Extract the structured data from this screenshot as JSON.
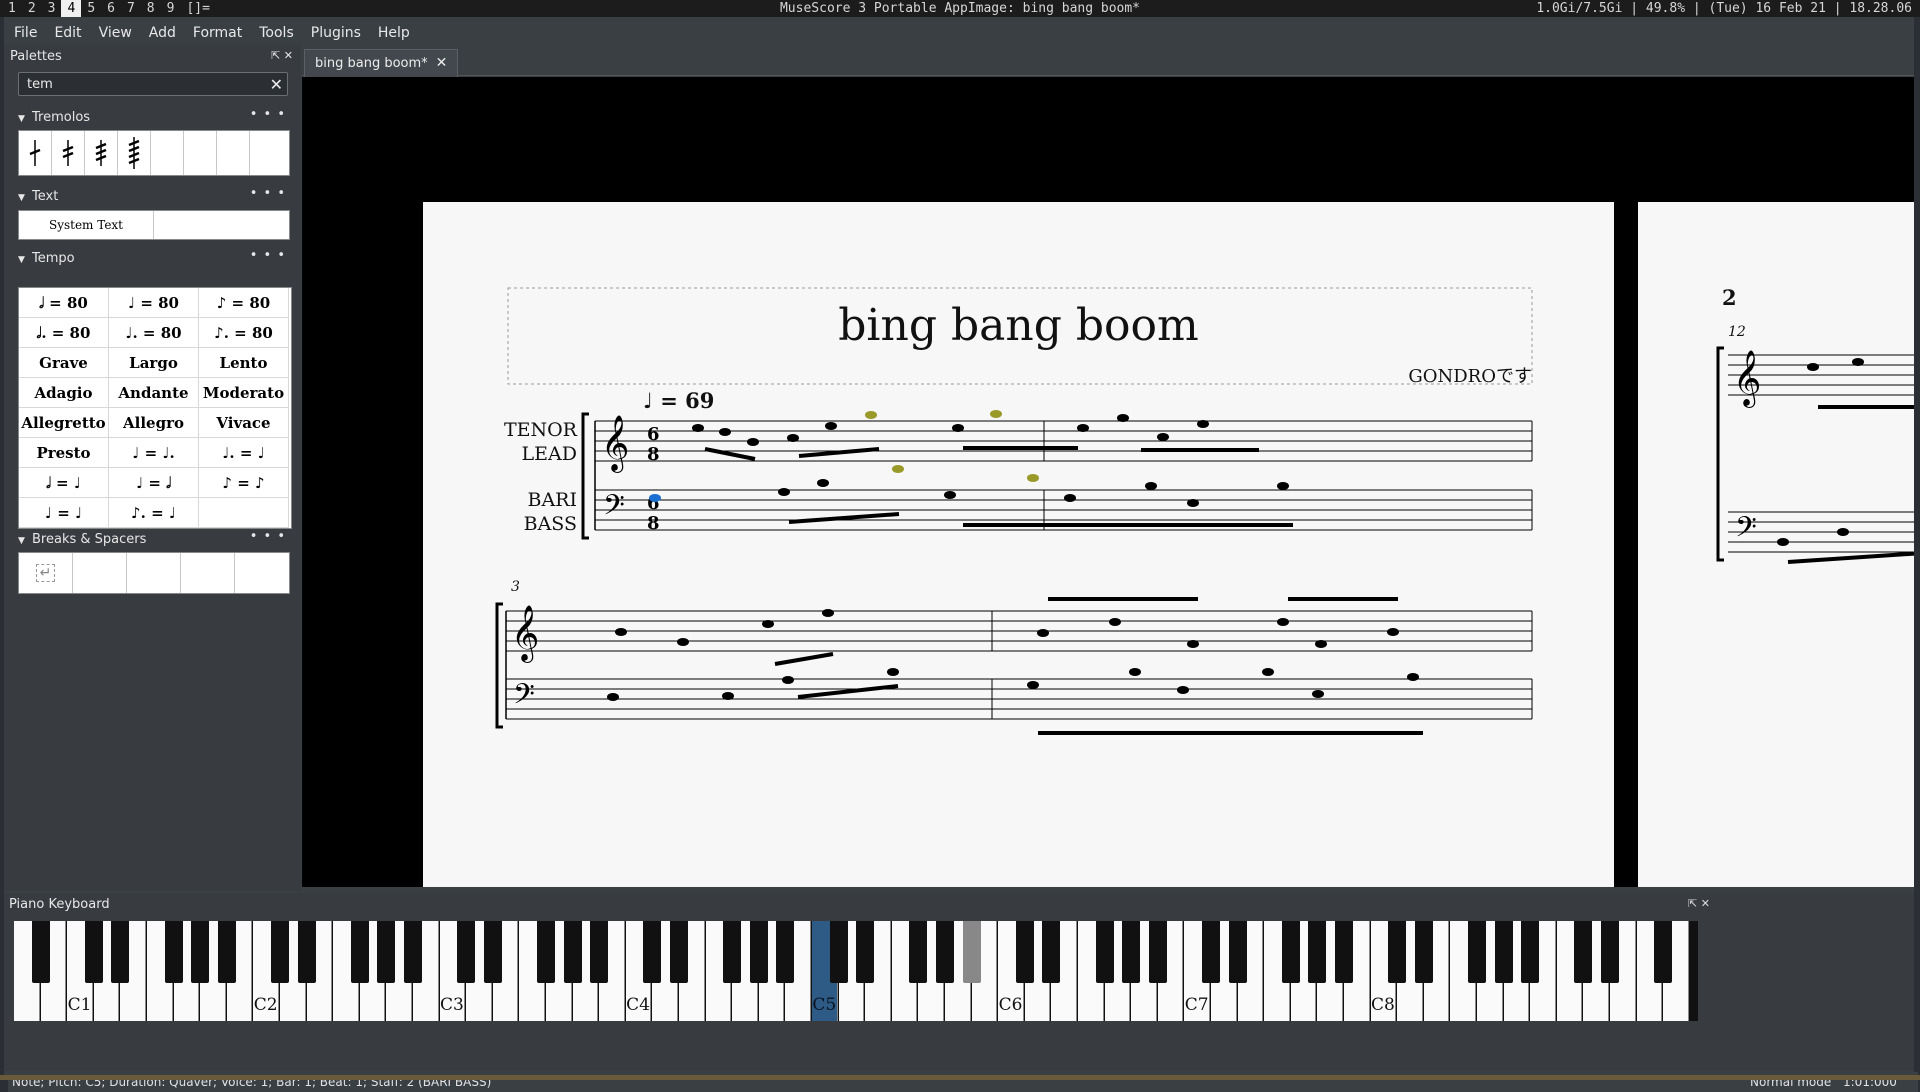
{
  "workspaces": [
    "1",
    "2",
    "3",
    "4",
    "5",
    "6",
    "7",
    "8",
    "9",
    "[]="
  ],
  "active_workspace": "4",
  "window_title": "MuseScore 3 Portable AppImage: bing bang boom*",
  "system_info": "1.0Gi/7.5Gi | 49.8% | (Tue) 16 Feb 21 | 18.28.06",
  "menu": [
    "File",
    "Edit",
    "View",
    "Add",
    "Format",
    "Tools",
    "Plugins",
    "Help"
  ],
  "palettes": {
    "title": "Palettes",
    "search_value": "tem",
    "sections": {
      "tremolos": "Tremolos",
      "text": "Text",
      "tempo": "Tempo",
      "breaks": "Breaks & Spacers"
    },
    "text_item": "System Text",
    "tempo_items": [
      "𝅗𝅥 = 80",
      "♩ = 80",
      "♪ = 80",
      "𝅗𝅥. = 80",
      "♩. = 80",
      "♪. = 80",
      "Grave",
      "Largo",
      "Lento",
      "Adagio",
      "Andante",
      "Moderato",
      "Allegretto",
      "Allegro",
      "Vivace",
      "Presto",
      "♩ = ♩.",
      "♩. = ♩",
      "𝅗𝅥 = ♩",
      "♩ = 𝅗𝅥",
      "♪ = ♪",
      "♩ = ♩",
      "♪. = ♩",
      ""
    ]
  },
  "tab": {
    "label": "bing bang boom*"
  },
  "score": {
    "title": "bing bang boom",
    "composer": "GONDROです",
    "tempo_marking": "♩ = 69",
    "staff1_name_line1": "TENOR",
    "staff1_name_line2": "LEAD",
    "staff2_name_line1": "BARI",
    "staff2_name_line2": "BASS",
    "measure_number_sys2": "3",
    "page2_number": "2",
    "page2_measure_number": "12"
  },
  "piano": {
    "title": "Piano Keyboard",
    "octave_labels": [
      "C1",
      "C2",
      "C3",
      "C4",
      "C5",
      "C6",
      "C7",
      "C8"
    ],
    "selected_key": "C5"
  },
  "status": {
    "note_info": "Note; Pitch: C5; Duration: Quaver; Voice: 1;  Bar: 1; Beat: 1; Staff: 2 (BARI BASS)",
    "mode": "Normal mode",
    "position": "1:01:000"
  },
  "colors": {
    "selected_note": "#1a6fd0",
    "highlight_note": "#9a9a2a",
    "piano_selected": "#2d5b86"
  }
}
